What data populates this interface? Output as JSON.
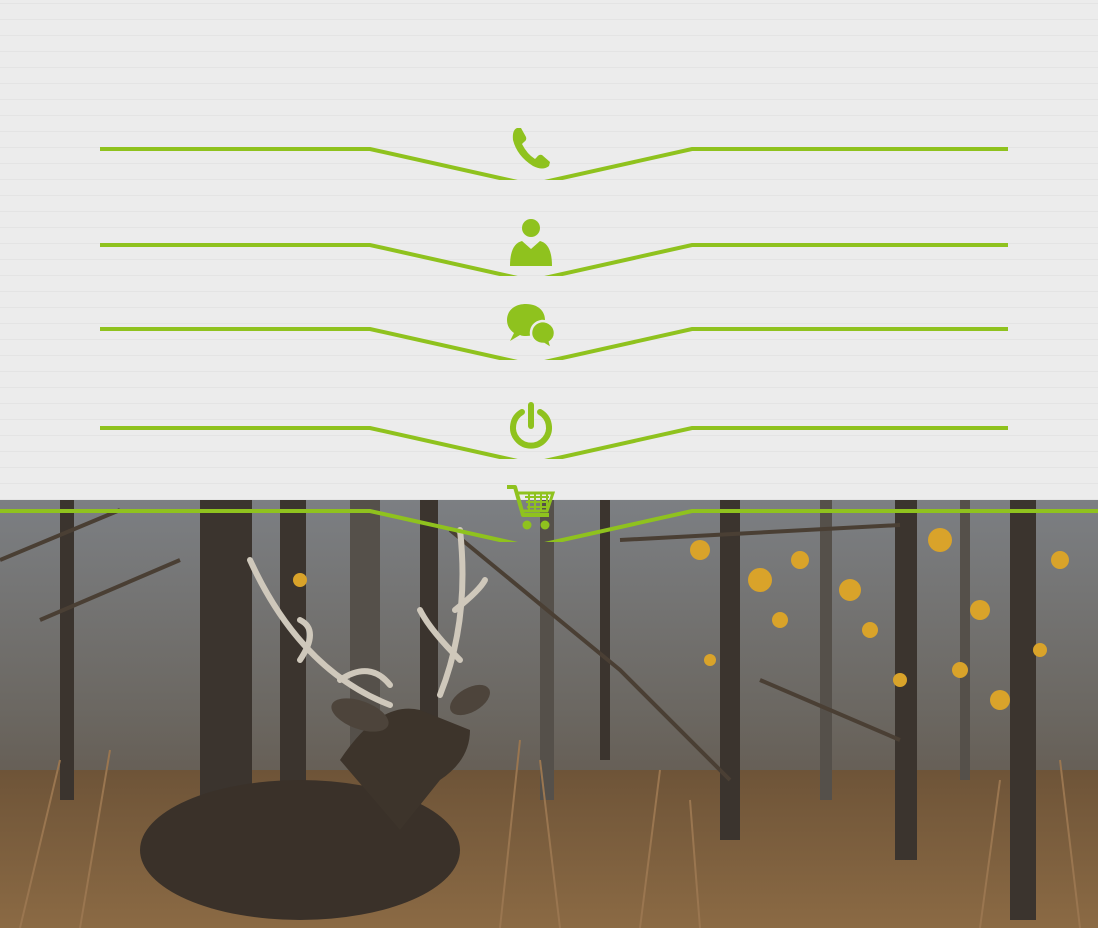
{
  "nav": {
    "items": [
      {
        "icon": "phone-icon"
      },
      {
        "icon": "user-icon"
      },
      {
        "icon": "chat-icon"
      },
      {
        "icon": "power-icon"
      },
      {
        "icon": "cart-icon"
      }
    ]
  },
  "colors": {
    "accent": "#8fc21e",
    "background": "#ececec"
  }
}
